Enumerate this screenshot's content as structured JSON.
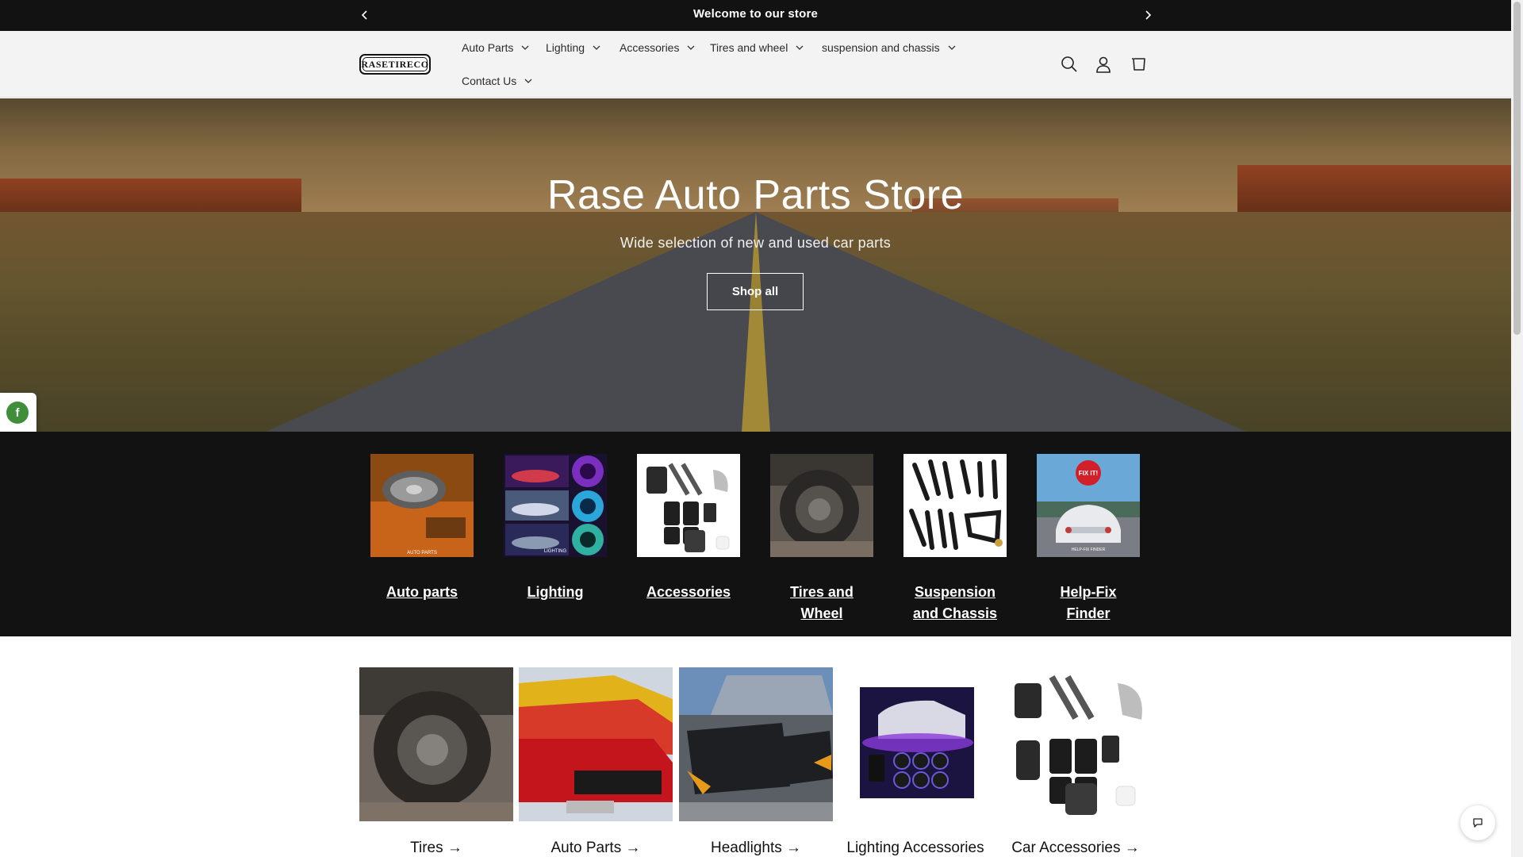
{
  "announcement": {
    "message": "Welcome to our store"
  },
  "header": {
    "logo_text": "RASETIRECO",
    "nav": [
      {
        "label": "Auto Parts"
      },
      {
        "label": "Lighting"
      },
      {
        "label": "Accessories"
      },
      {
        "label": "Tires and wheel"
      },
      {
        "label": "suspension and chassis"
      },
      {
        "label": "Contact Us"
      }
    ]
  },
  "hero": {
    "title": "Rase Auto Parts Store",
    "subtitle": "Wide selection of new and used car parts",
    "button": "Shop all"
  },
  "categories": [
    {
      "label": "Auto parts",
      "thumb_caption": "AUTO PARTS"
    },
    {
      "label": "Lighting",
      "thumb_caption": "LIGHTING"
    },
    {
      "label": "Accessories"
    },
    {
      "label": "Tires and Wheel"
    },
    {
      "label": "Suspension and Chassis"
    },
    {
      "label": "Help-Fix Finder",
      "thumb_caption": "HELP-FIX FINDER",
      "badge": "FIX IT!"
    }
  ],
  "collections": [
    {
      "label": "Tires →"
    },
    {
      "label": "Auto Parts →"
    },
    {
      "label": "Headlights →"
    },
    {
      "label": "Lighting Accessories →"
    },
    {
      "label": "Car Accessories →"
    }
  ],
  "social": [
    {
      "icon": "facebook-icon",
      "glyph": "f"
    },
    {
      "icon": "instagram-icon",
      "glyph": "◎"
    }
  ],
  "colors": {
    "bar": "#121212",
    "header_bg": "#f3f3f3",
    "social_green": "#3f8f3a"
  }
}
